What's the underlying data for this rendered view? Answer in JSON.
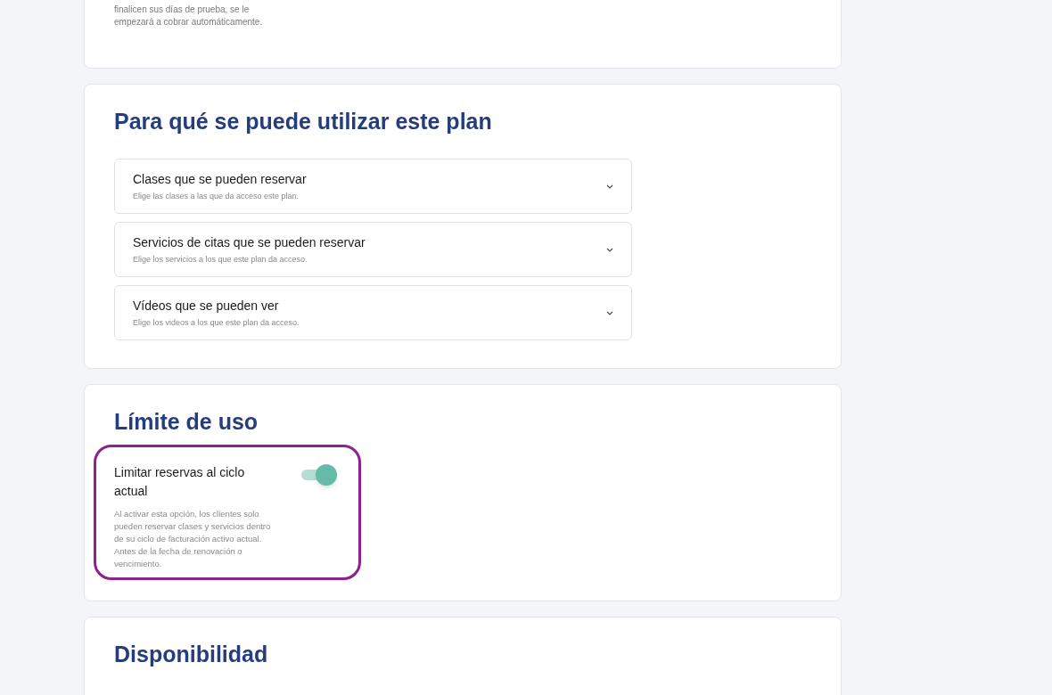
{
  "trial_note": {
    "lines": [
      "finalicen sus días de prueba, se le",
      "empezará a cobrar automáticamente."
    ]
  },
  "usage_section": {
    "title": "Para qué se puede utilizar este plan",
    "items": [
      {
        "title": "Clases que se pueden reservar",
        "description": "Elige las clases a las que da acceso este plan.",
        "expanded": false
      },
      {
        "title": "Servicios de citas que se pueden reservar",
        "description": "Elige los servicios a los que este plan da acceso.",
        "expanded": false
      },
      {
        "title": "Vídeos que se pueden ver",
        "description": "Elige los videos a los que este plan da acceso.",
        "expanded": false
      }
    ]
  },
  "limit_section": {
    "title": "Límite de uso",
    "setting": {
      "title": "Limitar reservas al ciclo actual",
      "description": "Al activar esta opción, los clientes solo pueden reservar clases y servicios dentro de su ciclo de facturación activo actual. Antes de la fecha de renovación o vencimiento.",
      "on": true
    }
  },
  "availability_section": {
    "title": "Disponibilidad"
  }
}
